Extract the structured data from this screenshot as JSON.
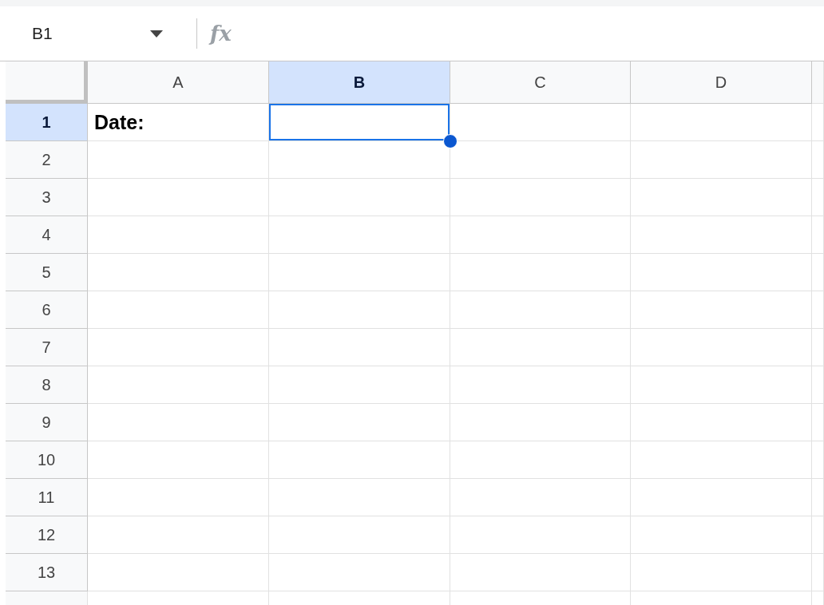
{
  "name_box": {
    "value": "B1"
  },
  "formula_bar": {
    "label": "fx"
  },
  "columns": [
    {
      "label": "A",
      "selected": false
    },
    {
      "label": "B",
      "selected": true
    },
    {
      "label": "C",
      "selected": false
    },
    {
      "label": "D",
      "selected": false
    }
  ],
  "rows": [
    {
      "label": "1",
      "selected": true,
      "cells": [
        "Date:"
      ]
    },
    {
      "label": "2",
      "selected": false
    },
    {
      "label": "3",
      "selected": false
    },
    {
      "label": "4",
      "selected": false
    },
    {
      "label": "5",
      "selected": false
    },
    {
      "label": "6",
      "selected": false
    },
    {
      "label": "7",
      "selected": false
    },
    {
      "label": "8",
      "selected": false
    },
    {
      "label": "9",
      "selected": false
    },
    {
      "label": "10",
      "selected": false
    },
    {
      "label": "11",
      "selected": false
    },
    {
      "label": "12",
      "selected": false
    },
    {
      "label": "13",
      "selected": false
    }
  ]
}
